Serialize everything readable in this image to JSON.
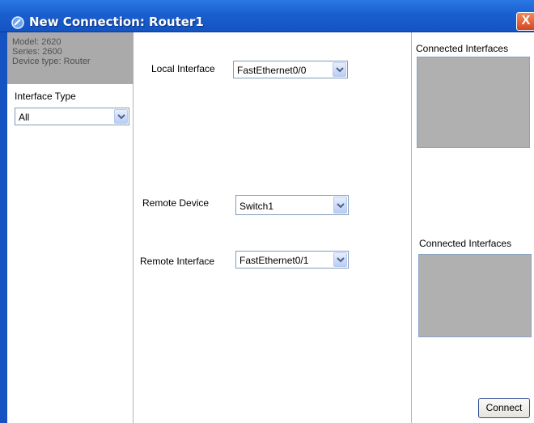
{
  "window": {
    "title": "New Connection: Router1",
    "close_glyph": "X"
  },
  "device": {
    "model": "Model: 2620",
    "series": "Series: 2600",
    "type": "Device type: Router"
  },
  "interface_type": {
    "label": "Interface Type",
    "selected": "All"
  },
  "local_interface": {
    "label": "Local Interface",
    "selected": "FastEthernet0/0"
  },
  "remote_device": {
    "label": "Remote Device",
    "selected": "Switch1"
  },
  "remote_interface": {
    "label": "Remote Interface",
    "selected": "FastEthernet0/1"
  },
  "connected_local": {
    "label": "Connected Interfaces"
  },
  "connected_remote": {
    "label": "Connected Interfaces"
  },
  "actions": {
    "connect_label": "Connect"
  },
  "colors": {
    "titlebar": "#1a5fcf",
    "listbox": "#b0b0b0",
    "device_info_bg": "#aaaaaa"
  },
  "icons": {
    "window_icon": "connection-icon",
    "close": "close-icon",
    "dropdown": "chevron-down-icon"
  }
}
